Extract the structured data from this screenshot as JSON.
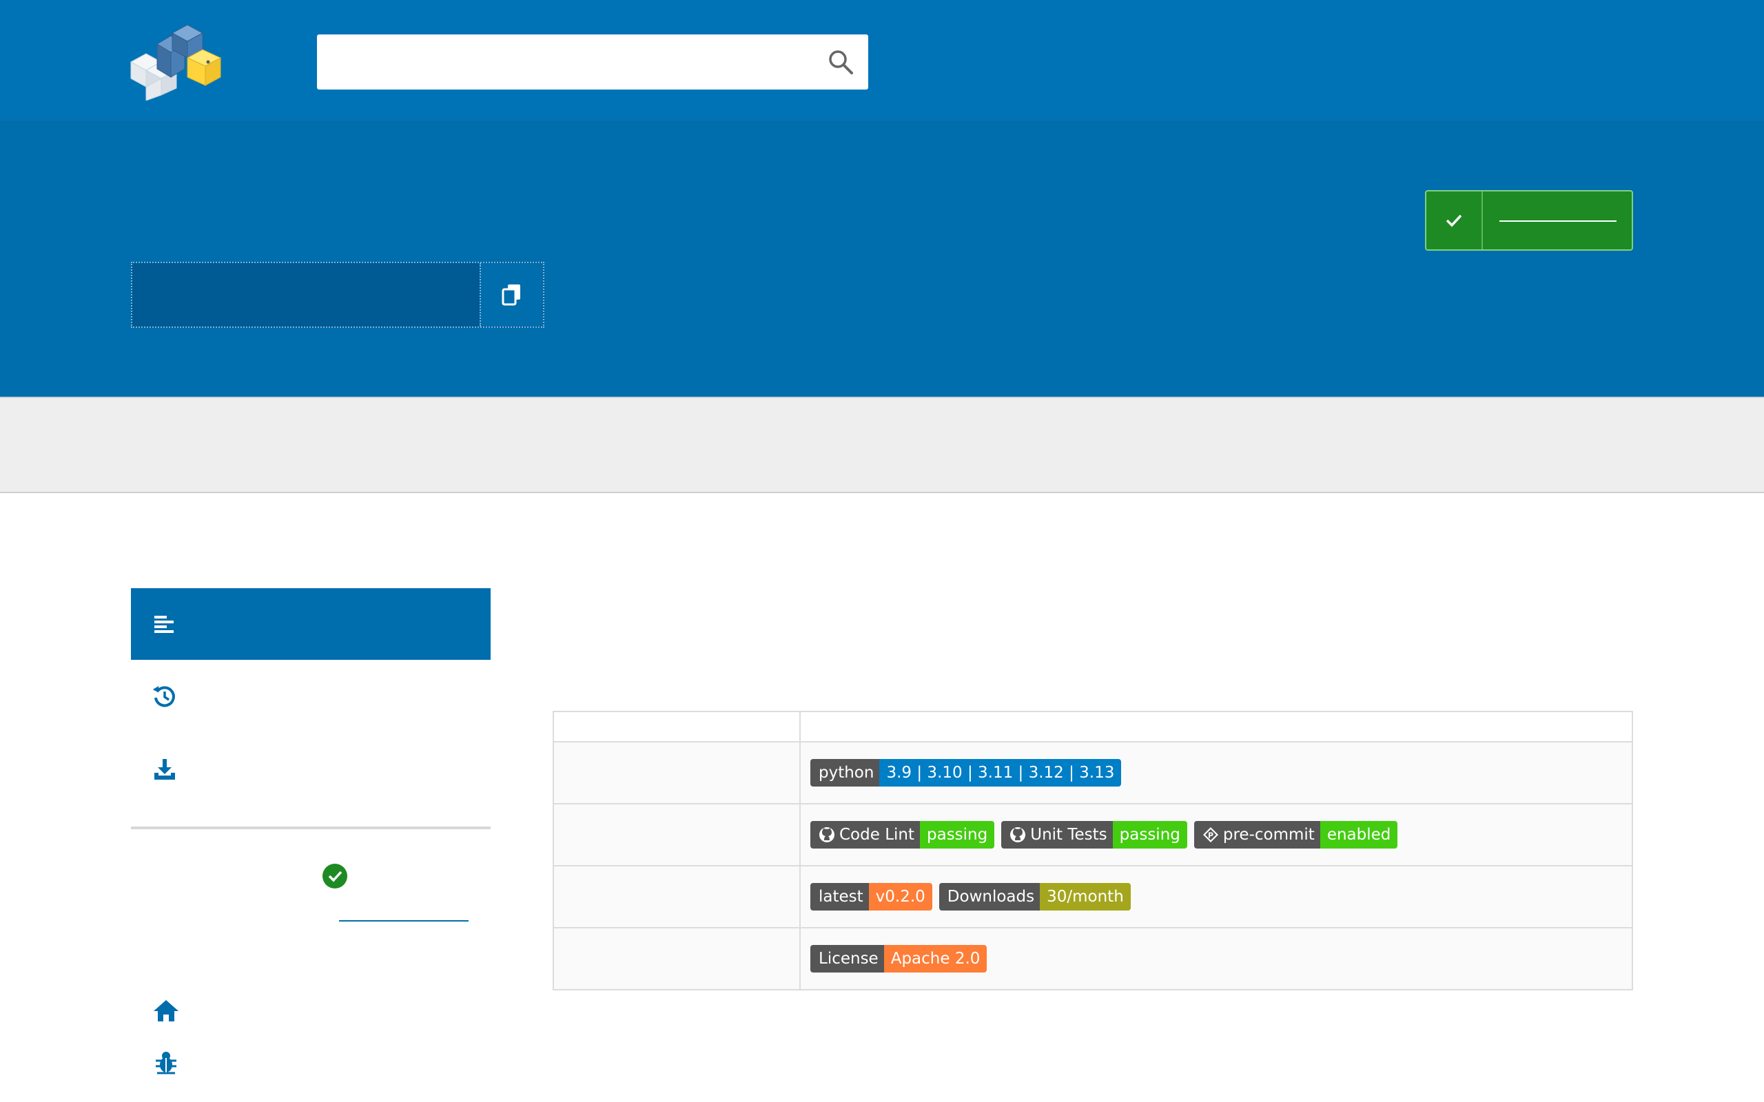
{
  "header": {
    "logo_icon": "pypi-cubes-logo",
    "search": {
      "placeholder": "",
      "value": "",
      "icon": "search-icon"
    }
  },
  "banner": {
    "pip_command": "",
    "copy_icon": "copy-icon",
    "latest_button": {
      "icon": "check-icon",
      "label": ""
    }
  },
  "sidebar": {
    "nav": [
      {
        "icon": "align-left-icon",
        "label": "",
        "active": true
      },
      {
        "icon": "history-icon",
        "label": "",
        "active": false
      },
      {
        "icon": "download-icon",
        "label": "",
        "active": false
      }
    ],
    "verified_icon": "check-circle-icon",
    "links": [
      {
        "icon": "home-icon",
        "label": ""
      },
      {
        "icon": "bug-icon",
        "label": ""
      }
    ]
  },
  "colors": {
    "header_blue": "#0073b7",
    "banner_blue": "#006dad",
    "success_green": "#1e8a24",
    "badge_gray": "#555555",
    "badge_blue": "#007ec6",
    "badge_green": "#44cc11",
    "badge_orange": "#fe7d37",
    "badge_olive": "#a4a61d"
  },
  "badges_table": {
    "rows": [
      {
        "badges": [
          {
            "left": "python",
            "right": "3.9 | 3.10 | 3.11 | 3.12 | 3.13",
            "color": "#007ec6",
            "icon": ""
          }
        ]
      },
      {
        "badges": [
          {
            "left": "Code Lint",
            "right": "passing",
            "color": "#44cc11",
            "icon": "github-icon"
          },
          {
            "left": "Unit Tests",
            "right": "passing",
            "color": "#44cc11",
            "icon": "github-icon"
          },
          {
            "left": "pre-commit",
            "right": "enabled",
            "color": "#44cc11",
            "icon": "pre-commit-icon"
          }
        ]
      },
      {
        "badges": [
          {
            "left": "latest",
            "right": "v0.2.0",
            "color": "#fe7d37",
            "icon": ""
          },
          {
            "left": "Downloads",
            "right": "30/month",
            "color": "#a4a61d",
            "icon": ""
          }
        ]
      },
      {
        "badges": [
          {
            "left": "License",
            "right": "Apache 2.0",
            "color": "#fe7d37",
            "icon": ""
          }
        ]
      }
    ]
  }
}
